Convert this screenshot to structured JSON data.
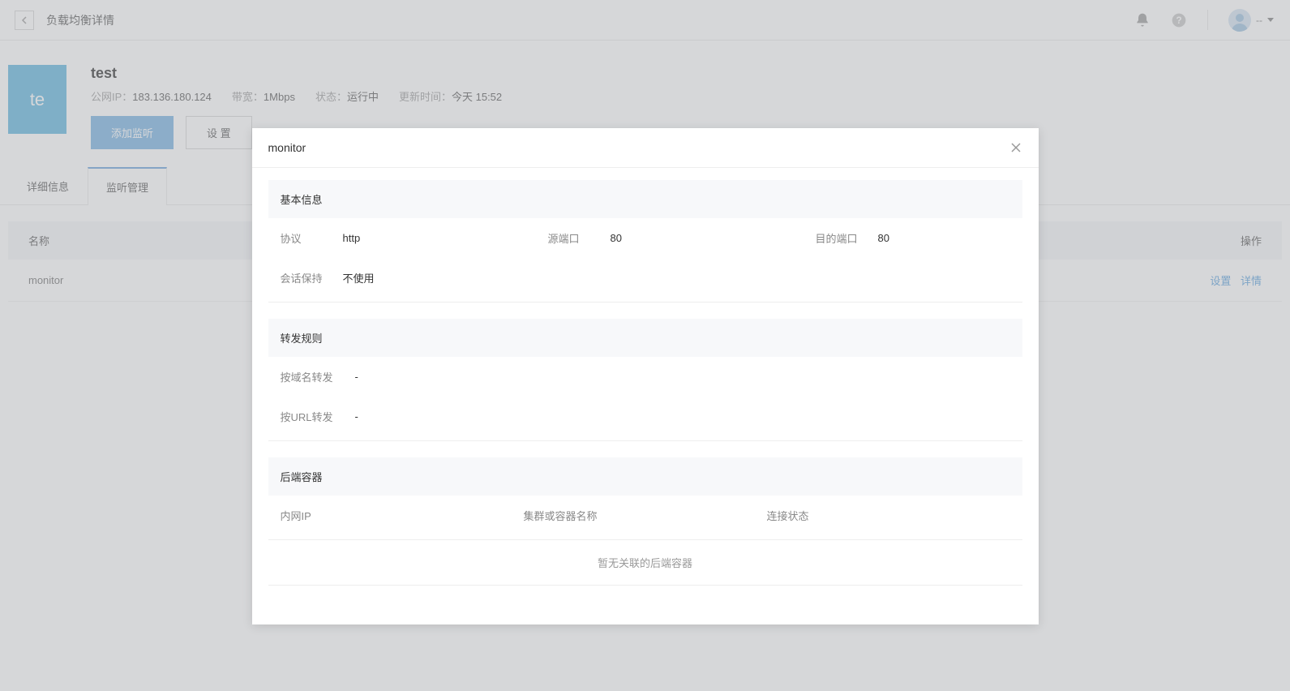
{
  "topbar": {
    "title": "负载均衡详情",
    "user_label": "--"
  },
  "lb": {
    "badge": "te",
    "name": "test",
    "public_ip_label": "公网IP：",
    "public_ip": "183.136.180.124",
    "bandwidth_label": "带宽：",
    "bandwidth": "1Mbps",
    "status_label": "状态：",
    "status": "运行中",
    "updated_label": "更新时间：",
    "updated": "今天 15:52",
    "add_listener": "添加监听",
    "settings": "设 置"
  },
  "tabs": {
    "detail": "详细信息",
    "listener": "监听管理"
  },
  "table": {
    "col_name": "名称",
    "col_action": "操作",
    "rows": [
      {
        "name": "monitor",
        "action_set": "设置",
        "action_detail": "详情"
      }
    ]
  },
  "modal": {
    "title": "monitor",
    "sections": {
      "basic": {
        "title": "基本信息",
        "protocol_label": "协议",
        "protocol": "http",
        "src_port_label": "源端口",
        "src_port": "80",
        "dst_port_label": "目的端口",
        "dst_port": "80",
        "session_label": "会话保持",
        "session": "不使用"
      },
      "rules": {
        "title": "转发规则",
        "domain_label": "按域名转发",
        "domain": "-",
        "url_label": "按URL转发",
        "url": "-"
      },
      "backend": {
        "title": "后端容器",
        "col_ip": "内网IP",
        "col_cluster": "集群或容器名称",
        "col_status": "连接状态",
        "empty": "暂无关联的后端容器"
      }
    }
  }
}
